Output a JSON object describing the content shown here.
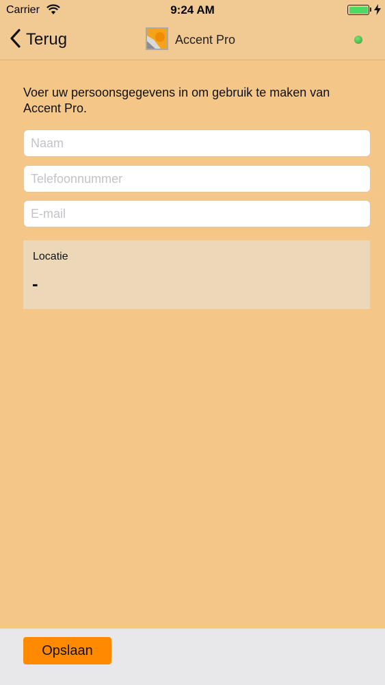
{
  "status_bar": {
    "carrier": "Carrier",
    "time": "9:24 AM",
    "battery_color": "#4cd964"
  },
  "nav": {
    "back_label": "Terug",
    "title": "Accent Pro",
    "connection_status_color": "#3cb043"
  },
  "form": {
    "intro": "Voer uw persoonsgegevens in om gebruik te maken van Accent Pro.",
    "name_placeholder": "Naam",
    "phone_placeholder": "Telefoonnummer",
    "email_placeholder": "E-mail",
    "location_label": "Locatie",
    "location_value": "-"
  },
  "footer": {
    "save_label": "Opslaan",
    "save_color": "#ff8a00"
  },
  "colors": {
    "background": "#f4c688",
    "nav_background": "#f1c993",
    "location_background": "#ecd8b8",
    "footer_background": "#e8e8ea"
  }
}
